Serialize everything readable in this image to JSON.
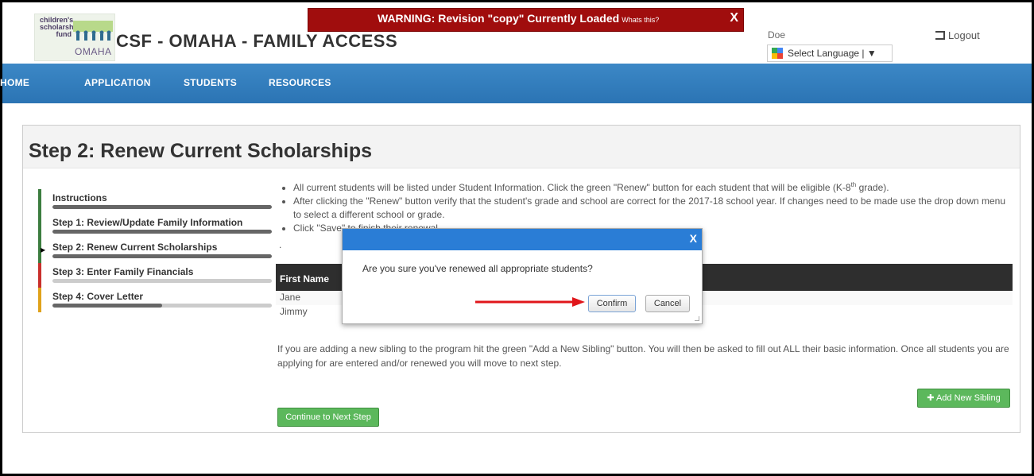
{
  "header": {
    "logo": {
      "line1": "children's",
      "line2": "scholarship",
      "line3": "fund",
      "city": "OMAHA"
    },
    "title": "CSF - OMAHA - FAMILY ACCESS",
    "user_name": "Doe",
    "logout_label": "Logout",
    "language_label": "Select Language",
    "language_caret": "▼"
  },
  "warning": {
    "message": "WARNING: Revision \"copy\" Currently Loaded",
    "whats_this": "Whats this?",
    "close": "X",
    "color": "#a00d0d"
  },
  "nav": {
    "items": [
      "HOME",
      "APPLICATION",
      "STUDENTS",
      "RESOURCES"
    ],
    "color": "#2b74b4"
  },
  "page": {
    "title": "Step 2: Renew Current Scholarships"
  },
  "steps": [
    {
      "label": "Instructions",
      "color": "#3c7d3f",
      "progress": 1.0
    },
    {
      "label": "Step 1: Review/Update Family Information",
      "color": "#3c7d3f",
      "progress": 1.0
    },
    {
      "label": "Step 2: Renew Current Scholarships",
      "color": "#3c7d3f",
      "progress": 1.0,
      "active": true
    },
    {
      "label": "Step 3: Enter Family Financials",
      "color": "#c9302c",
      "progress": 0
    },
    {
      "label": "Step 4: Cover Letter",
      "color": "#e0a21b",
      "progress": 0.5
    }
  ],
  "instructions": {
    "b1_pre": "All current students will be listed under Student Information. Click the green \"Renew\" button for each student that will be eligible (K-8",
    "b1_sup": "th",
    "b1_post": " grade).",
    "b2": "After clicking the \"Renew\" button verify that the student's grade and school are correct for the 2017-18 school year. If changes need to be made use the drop down menu to select a different school or grade.",
    "b3": "Click \"Save\" to finish their renewal.",
    "dot": "."
  },
  "table": {
    "columns": [
      "First Name"
    ],
    "rows": [
      [
        "Jane"
      ],
      [
        "Jimmy"
      ]
    ]
  },
  "sibling_text": "If you are adding a new sibling to the program hit the green \"Add a New Sibling\" button. You will then be asked to fill out ALL their basic information. Once all students you are applying for are entered and/or renewed you will move to next step.",
  "buttons": {
    "add_sibling": "Add New Sibling",
    "continue": "Continue to Next Step"
  },
  "modal": {
    "close": "X",
    "message": "Are you sure you've renewed all appropriate students?",
    "confirm": "Confirm",
    "cancel": "Cancel"
  }
}
